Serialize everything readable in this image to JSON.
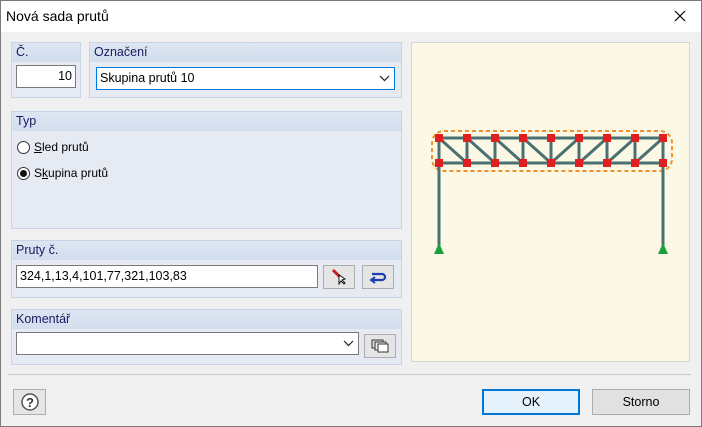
{
  "window": {
    "title": "Nová sada prutů"
  },
  "number": {
    "label": "Č.",
    "value": "10"
  },
  "designation": {
    "label": "Označení",
    "value": "Skupina prutů 10"
  },
  "type": {
    "label": "Typ",
    "options": [
      {
        "prefix": "",
        "accel": "S",
        "rest": "led prutů",
        "selected": false
      },
      {
        "prefix": "S",
        "accel": "k",
        "rest": "upina prutů",
        "selected": true
      }
    ]
  },
  "members": {
    "label": "Pruty č.",
    "value": "324,1,13,4,101,77,321,103,83"
  },
  "comment": {
    "label": "Komentář",
    "value": ""
  },
  "buttons": {
    "ok": "OK",
    "cancel": "Storno"
  },
  "colors": {
    "accent": "#0078d7",
    "node": "#e02020",
    "member": "#4a7070",
    "support": "#1aa038",
    "highlight": "#f0902a"
  },
  "icons": [
    "close-icon",
    "chevron-down-icon",
    "pick-members-icon",
    "refresh-icon",
    "comment-library-icon",
    "help-icon"
  ]
}
